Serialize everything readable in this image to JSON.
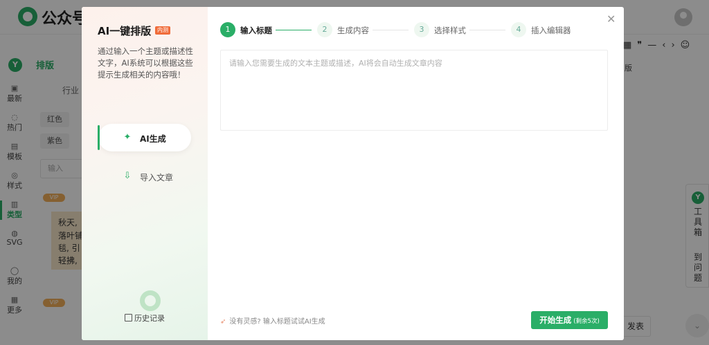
{
  "app": {
    "logo_text": "公众号",
    "rail": [
      {
        "label": "最新",
        "icon": "news-icon"
      },
      {
        "label": "热门",
        "icon": "fire-icon"
      },
      {
        "label": "模板",
        "icon": "template-icon"
      },
      {
        "label": "样式",
        "icon": "style-icon"
      },
      {
        "label": "类型",
        "icon": "type-icon"
      },
      {
        "label": "SVG",
        "icon": "svg-icon"
      },
      {
        "label": "我的",
        "icon": "user-icon"
      },
      {
        "label": "更多",
        "icon": "more-icon"
      }
    ],
    "layout_tab": "排版",
    "category": "行业",
    "chips": [
      "红色",
      "紫色"
    ],
    "search_placeholder": "输入",
    "vip_label": "VIP",
    "card_lines": [
      "秋天,",
      "落叶铺",
      "毯, 引",
      "轻拂,"
    ],
    "editor_label": "版",
    "toolbox_label": "工具箱",
    "toolbox_label2": "到问题",
    "right_button": "发表"
  },
  "modal": {
    "title": "AI一键排版",
    "badge": "内测",
    "description": "通过输入一个主题或描述性文字，AI系统可以根据这些提示生成相关的内容哦！",
    "modes": [
      {
        "label": "AI生成",
        "icon": "magic-wand-icon",
        "active": true
      },
      {
        "label": "导入文章",
        "icon": "import-icon",
        "active": false
      }
    ],
    "history": "历史记录",
    "steps": [
      {
        "num": "1",
        "label": "输入标题",
        "active": true
      },
      {
        "num": "2",
        "label": "生成内容",
        "active": false
      },
      {
        "num": "3",
        "label": "选择样式",
        "active": false
      },
      {
        "num": "4",
        "label": "插入编辑器",
        "active": false
      }
    ],
    "prompt_placeholder": "请输入您需要生成的文本主题或描述，AI将会自动生成文章内容",
    "hint": "没有灵感? 输入标题试试AI生成",
    "start_label": "开始生成",
    "start_sub": "(剩余5次)"
  },
  "colors": {
    "accent": "#2aae67",
    "badge": "#f06c3a",
    "overlay": "rgba(0,0,0,0.45)"
  }
}
